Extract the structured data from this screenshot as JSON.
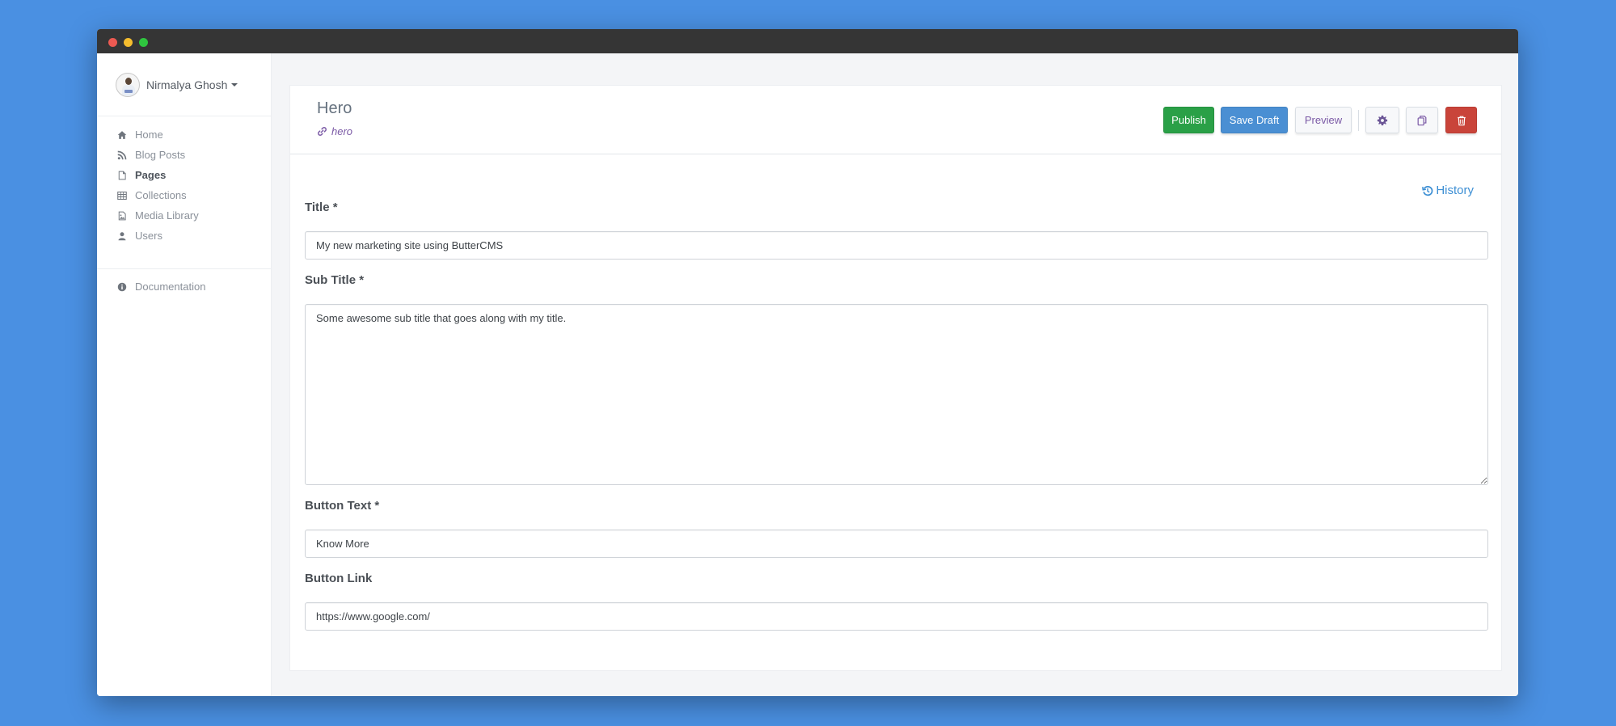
{
  "window": {
    "controls": [
      "close",
      "minimize",
      "maximize"
    ]
  },
  "sidebar": {
    "user": {
      "name": "Nirmalya Ghosh",
      "avatar_icon": "user-avatar",
      "dropdown_icon": "caret-down-icon"
    },
    "nav": [
      {
        "label": "Home",
        "icon": "home-icon",
        "active": false
      },
      {
        "label": "Blog Posts",
        "icon": "rss-icon",
        "active": false
      },
      {
        "label": "Pages",
        "icon": "file-icon",
        "active": true
      },
      {
        "label": "Collections",
        "icon": "table-icon",
        "active": false
      },
      {
        "label": "Media Library",
        "icon": "image-file-icon",
        "active": false
      },
      {
        "label": "Users",
        "icon": "user-icon",
        "active": false
      }
    ],
    "secondary_nav": [
      {
        "label": "Documentation",
        "icon": "info-circle-icon"
      }
    ]
  },
  "header": {
    "title": "Hero",
    "slug": "hero",
    "slug_icon": "link-icon",
    "actions": {
      "publish": "Publish",
      "save_draft": "Save Draft",
      "preview": "Preview",
      "settings_icon": "gear-icon",
      "duplicate_icon": "copy-icon",
      "delete_icon": "trash-icon"
    }
  },
  "history": {
    "label": "History",
    "icon": "history-icon"
  },
  "form": {
    "fields": [
      {
        "label": "Title *",
        "value": "My new marketing site using ButterCMS",
        "type": "text"
      },
      {
        "label": "Sub Title *",
        "value": "Some awesome sub title that goes along with my title.",
        "type": "textarea"
      },
      {
        "label": "Button Text *",
        "value": "Know More",
        "type": "text"
      },
      {
        "label": "Button Link",
        "value": "https://www.google.com/",
        "type": "text"
      }
    ]
  },
  "colors": {
    "background": "#4a90e2",
    "titlebar": "#353535",
    "publish": "#2aa047",
    "save_draft": "#4a8fd3",
    "delete": "#c9443a",
    "accent_purple": "#7b5aa6",
    "link_blue": "#3d8fd4"
  }
}
